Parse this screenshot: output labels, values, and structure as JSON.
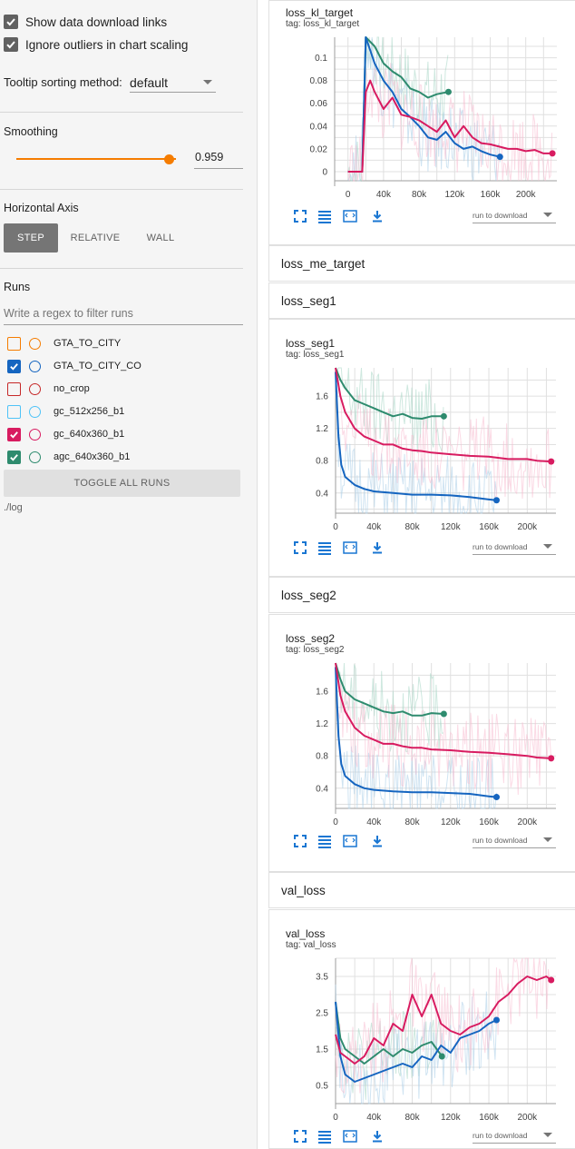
{
  "options": {
    "show_download": "Show data download links",
    "ignore_outliers": "Ignore outliers in chart scaling",
    "tooltip_label": "Tooltip sorting method:",
    "tooltip_value": "default"
  },
  "smoothing": {
    "title": "Smoothing",
    "value": "0.959",
    "fraction": 0.959
  },
  "horizontal_axis": {
    "title": "Horizontal Axis",
    "step": "STEP",
    "relative": "RELATIVE",
    "wall": "WALL",
    "selected": "STEP"
  },
  "runs": {
    "title": "Runs",
    "filter_placeholder": "Write a regex to filter runs",
    "items": [
      {
        "name": "GTA_TO_CITY",
        "color": "#f57c00",
        "checked": false
      },
      {
        "name": "GTA_TO_CITY_CO",
        "color": "#1565c0",
        "checked": true
      },
      {
        "name": "no_crop",
        "color": "#c62828",
        "checked": false
      },
      {
        "name": "gc_512x256_b1",
        "color": "#4fc3f7",
        "checked": false
      },
      {
        "name": "gc_640x360_b1",
        "color": "#d81b60",
        "checked": true
      },
      {
        "name": "agc_640x360_b1",
        "color": "#2e8b6e",
        "checked": true
      }
    ],
    "toggle_all": "TOGGLE ALL RUNS",
    "log_path": "./log"
  },
  "cards": {
    "kl": {
      "title": "loss_kl_target",
      "tag": "tag: loss_kl_target",
      "run_download": "run to download"
    },
    "me_header": "loss_me_target",
    "seg1_header": "loss_seg1",
    "seg1": {
      "title": "loss_seg1",
      "tag": "tag: loss_seg1",
      "run_download": "run to download"
    },
    "seg2_header": "loss_seg2",
    "seg2": {
      "title": "loss_seg2",
      "tag": "tag: loss_seg2",
      "run_download": "run to download"
    },
    "val_header": "val_loss",
    "val": {
      "title": "val_loss",
      "tag": "tag: val_loss",
      "run_download": "run to download"
    }
  },
  "chart_data": [
    {
      "type": "line",
      "title": "loss_kl_target",
      "xlim": [
        -15000,
        235000
      ],
      "ylim": [
        -0.008,
        0.118
      ],
      "xticks": [
        0,
        40000,
        80000,
        120000,
        160000,
        200000
      ],
      "xtick_labels": [
        "0",
        "40k",
        "80k",
        "120k",
        "160k",
        "200k"
      ],
      "yticks": [
        0,
        0.02,
        0.04,
        0.06,
        0.08,
        0.1
      ],
      "ytick_labels": [
        "0",
        "0.02",
        "0.04",
        "0.06",
        "0.08",
        "0.1"
      ],
      "series": [
        {
          "name": "agc_640x360_b1",
          "color": "#2e8b6e",
          "x": [
            0,
            12000,
            16000,
            20000,
            30000,
            40000,
            50000,
            60000,
            70000,
            80000,
            90000,
            100000,
            113000
          ],
          "y": [
            0,
            0,
            0,
            0.118,
            0.11,
            0.095,
            0.088,
            0.083,
            0.073,
            0.07,
            0.065,
            0.068,
            0.07
          ]
        },
        {
          "name": "GTA_TO_CITY_CO",
          "color": "#1565c0",
          "x": [
            0,
            12000,
            16000,
            20000,
            30000,
            40000,
            50000,
            60000,
            70000,
            80000,
            90000,
            100000,
            110000,
            120000,
            130000,
            140000,
            150000,
            160000,
            171000
          ],
          "y": [
            0,
            0,
            0,
            0.118,
            0.095,
            0.08,
            0.07,
            0.055,
            0.048,
            0.04,
            0.03,
            0.028,
            0.035,
            0.025,
            0.02,
            0.022,
            0.018,
            0.015,
            0.013
          ]
        },
        {
          "name": "gc_640x360_b1",
          "color": "#d81b60",
          "x": [
            0,
            12000,
            16000,
            20000,
            25000,
            30000,
            40000,
            50000,
            60000,
            70000,
            80000,
            90000,
            100000,
            110000,
            120000,
            130000,
            140000,
            150000,
            160000,
            170000,
            180000,
            190000,
            200000,
            210000,
            220000,
            230000
          ],
          "y": [
            0,
            0,
            0,
            0.07,
            0.08,
            0.07,
            0.055,
            0.065,
            0.05,
            0.048,
            0.045,
            0.04,
            0.035,
            0.045,
            0.03,
            0.04,
            0.03,
            0.025,
            0.024,
            0.022,
            0.02,
            0.02,
            0.018,
            0.019,
            0.016,
            0.016
          ]
        }
      ]
    },
    {
      "type": "line",
      "title": "loss_seg1",
      "xlim": [
        0,
        230000
      ],
      "ylim": [
        0.15,
        1.95
      ],
      "xticks": [
        0,
        40000,
        80000,
        120000,
        160000,
        200000
      ],
      "xtick_labels": [
        "0",
        "40k",
        "80k",
        "120k",
        "160k",
        "200k"
      ],
      "yticks": [
        0.4,
        0.8,
        1.2,
        1.6
      ],
      "ytick_labels": [
        "0.4",
        "0.8",
        "1.2",
        "1.6"
      ],
      "series": [
        {
          "name": "agc_640x360_b1",
          "color": "#2e8b6e",
          "x": [
            0,
            5000,
            10000,
            20000,
            30000,
            40000,
            50000,
            60000,
            70000,
            80000,
            90000,
            100000,
            113000
          ],
          "y": [
            1.95,
            1.8,
            1.7,
            1.55,
            1.5,
            1.45,
            1.4,
            1.35,
            1.38,
            1.33,
            1.32,
            1.35,
            1.35
          ]
        },
        {
          "name": "GTA_TO_CITY_CO",
          "color": "#1565c0",
          "x": [
            0,
            3000,
            6000,
            10000,
            20000,
            30000,
            40000,
            60000,
            80000,
            100000,
            120000,
            140000,
            160000,
            168000
          ],
          "y": [
            1.9,
            1.1,
            0.75,
            0.6,
            0.5,
            0.45,
            0.42,
            0.4,
            0.38,
            0.38,
            0.37,
            0.35,
            0.32,
            0.31
          ]
        },
        {
          "name": "gc_640x360_b1",
          "color": "#d81b60",
          "x": [
            0,
            5000,
            10000,
            20000,
            30000,
            40000,
            50000,
            60000,
            70000,
            80000,
            90000,
            100000,
            120000,
            140000,
            160000,
            180000,
            200000,
            210000,
            225000
          ],
          "y": [
            1.95,
            1.6,
            1.4,
            1.2,
            1.1,
            1.05,
            1.0,
            1.0,
            0.95,
            0.93,
            0.92,
            0.9,
            0.88,
            0.86,
            0.85,
            0.82,
            0.82,
            0.8,
            0.79
          ]
        }
      ]
    },
    {
      "type": "line",
      "title": "loss_seg2",
      "xlim": [
        0,
        230000
      ],
      "ylim": [
        0.15,
        1.95
      ],
      "xticks": [
        0,
        40000,
        80000,
        120000,
        160000,
        200000
      ],
      "xtick_labels": [
        "0",
        "40k",
        "80k",
        "120k",
        "160k",
        "200k"
      ],
      "yticks": [
        0.4,
        0.8,
        1.2,
        1.6
      ],
      "ytick_labels": [
        "0.4",
        "0.8",
        "1.2",
        "1.6"
      ],
      "series": [
        {
          "name": "agc_640x360_b1",
          "color": "#2e8b6e",
          "x": [
            0,
            5000,
            10000,
            20000,
            30000,
            40000,
            50000,
            60000,
            70000,
            80000,
            90000,
            100000,
            113000
          ],
          "y": [
            1.95,
            1.75,
            1.6,
            1.5,
            1.45,
            1.4,
            1.35,
            1.33,
            1.35,
            1.3,
            1.3,
            1.33,
            1.32
          ]
        },
        {
          "name": "GTA_TO_CITY_CO",
          "color": "#1565c0",
          "x": [
            0,
            3000,
            6000,
            10000,
            20000,
            30000,
            40000,
            60000,
            80000,
            100000,
            120000,
            140000,
            160000,
            168000
          ],
          "y": [
            1.9,
            1.05,
            0.7,
            0.55,
            0.45,
            0.4,
            0.38,
            0.36,
            0.35,
            0.35,
            0.34,
            0.33,
            0.3,
            0.29
          ]
        },
        {
          "name": "gc_640x360_b1",
          "color": "#d81b60",
          "x": [
            0,
            5000,
            10000,
            20000,
            30000,
            40000,
            50000,
            60000,
            70000,
            80000,
            90000,
            100000,
            120000,
            140000,
            160000,
            180000,
            200000,
            210000,
            225000
          ],
          "y": [
            1.95,
            1.55,
            1.35,
            1.15,
            1.05,
            1.0,
            0.95,
            0.95,
            0.92,
            0.9,
            0.9,
            0.88,
            0.87,
            0.85,
            0.84,
            0.82,
            0.8,
            0.78,
            0.77
          ]
        }
      ]
    },
    {
      "type": "line",
      "title": "val_loss",
      "xlim": [
        0,
        230000
      ],
      "ylim": [
        0,
        4.0
      ],
      "xticks": [
        0,
        40000,
        80000,
        120000,
        160000,
        200000
      ],
      "xtick_labels": [
        "0",
        "40k",
        "80k",
        "120k",
        "160k",
        "200k"
      ],
      "yticks": [
        0.5,
        1.5,
        2.5,
        3.5
      ],
      "ytick_labels": [
        "0.5",
        "1.5",
        "2.5",
        "3.5"
      ],
      "series": [
        {
          "name": "agc_640x360_b1",
          "color": "#2e8b6e",
          "x": [
            0,
            5000,
            10000,
            20000,
            30000,
            40000,
            50000,
            60000,
            70000,
            80000,
            90000,
            100000,
            111000
          ],
          "y": [
            2.8,
            1.8,
            1.5,
            1.3,
            1.1,
            1.3,
            1.5,
            1.3,
            1.5,
            1.4,
            1.6,
            1.7,
            1.3
          ]
        },
        {
          "name": "GTA_TO_CITY_CO",
          "color": "#1565c0",
          "x": [
            0,
            5000,
            10000,
            20000,
            30000,
            40000,
            50000,
            60000,
            70000,
            80000,
            90000,
            100000,
            110000,
            120000,
            130000,
            140000,
            150000,
            160000,
            168000
          ],
          "y": [
            2.8,
            1.3,
            0.8,
            0.6,
            0.7,
            0.8,
            0.9,
            1.0,
            1.1,
            1.0,
            1.3,
            1.2,
            1.6,
            1.4,
            1.8,
            1.9,
            2.0,
            2.2,
            2.3
          ]
        },
        {
          "name": "gc_640x360_b1",
          "color": "#d81b60",
          "x": [
            0,
            5000,
            10000,
            20000,
            30000,
            40000,
            50000,
            60000,
            70000,
            80000,
            90000,
            100000,
            110000,
            120000,
            130000,
            140000,
            150000,
            160000,
            170000,
            180000,
            190000,
            200000,
            210000,
            220000,
            225000
          ],
          "y": [
            1.9,
            1.4,
            1.3,
            1.1,
            1.3,
            1.8,
            1.6,
            2.2,
            2.0,
            3.0,
            2.4,
            3.0,
            2.2,
            2.0,
            1.9,
            2.1,
            2.2,
            2.4,
            2.8,
            3.0,
            3.3,
            3.5,
            3.4,
            3.5,
            3.4
          ]
        }
      ]
    }
  ]
}
